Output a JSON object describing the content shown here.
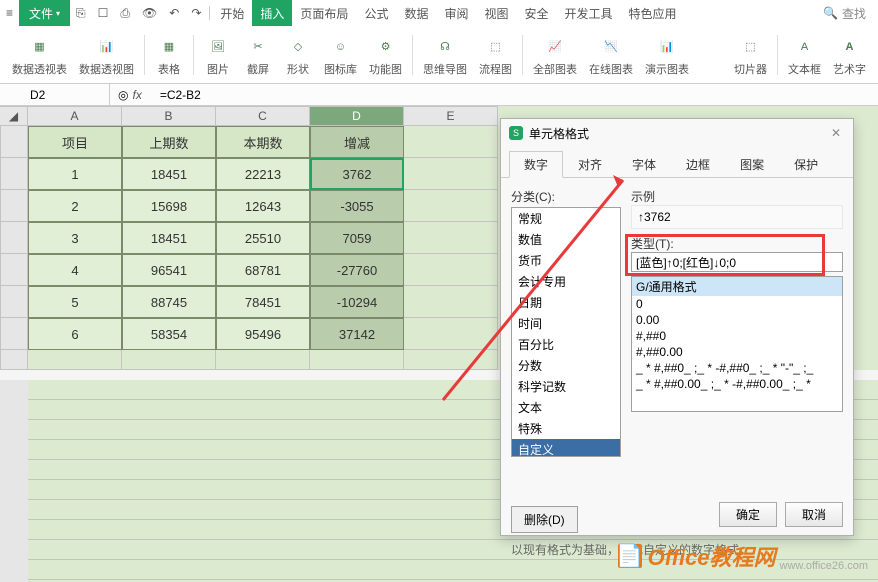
{
  "app": {
    "file_menu": "文件",
    "search": "查找"
  },
  "quickaccess": [
    "home-icon",
    "save-icon",
    "print-icon",
    "preview-icon",
    "undo-icon",
    "redo-icon"
  ],
  "tabs": {
    "start": "开始",
    "insert": "插入",
    "layout": "页面布局",
    "formula": "公式",
    "data": "数据",
    "review": "审阅",
    "view": "视图",
    "security": "安全",
    "dev": "开发工具",
    "special": "特色应用"
  },
  "ribbon": {
    "pivot": "数据透视表",
    "pivotchart": "数据透视图",
    "table": "表格",
    "picture": "图片",
    "screenshot": "截屏",
    "shapes": "形状",
    "icons": "图标库",
    "function": "功能图",
    "mindmap": "思维导图",
    "flowchart": "流程图",
    "allcharts": "全部图表",
    "onlinechart": "在线图表",
    "presentchart": "演示图表",
    "slicer": "切片器",
    "textbox": "文本框",
    "wordart": "艺术字"
  },
  "formula_bar": {
    "cell": "D2",
    "formula": "=C2-B2"
  },
  "table": {
    "cols": [
      "A",
      "B",
      "C",
      "D",
      "E"
    ],
    "headers": {
      "a": "项目",
      "b": "上期数",
      "c": "本期数",
      "d": "增减"
    },
    "rows": [
      {
        "a": "1",
        "b": "18451",
        "c": "22213",
        "d": "3762"
      },
      {
        "a": "2",
        "b": "15698",
        "c": "12643",
        "d": "-3055"
      },
      {
        "a": "3",
        "b": "18451",
        "c": "25510",
        "d": "7059"
      },
      {
        "a": "4",
        "b": "96541",
        "c": "68781",
        "d": "-27760"
      },
      {
        "a": "5",
        "b": "88745",
        "c": "78451",
        "d": "-10294"
      },
      {
        "a": "6",
        "b": "58354",
        "c": "95496",
        "d": "37142"
      }
    ]
  },
  "dialog": {
    "title": "单元格格式",
    "tabs": {
      "number": "数字",
      "align": "对齐",
      "font": "字体",
      "border": "边框",
      "pattern": "图案",
      "protect": "保护"
    },
    "category_label": "分类(C):",
    "categories": [
      "常规",
      "数值",
      "货币",
      "会计专用",
      "日期",
      "时间",
      "百分比",
      "分数",
      "科学记数",
      "文本",
      "特殊",
      "自定义"
    ],
    "selected_category": "自定义",
    "example_label": "示例",
    "example_value": "↑3762",
    "type_label": "类型(T):",
    "type_value": "[蓝色]↑0;[红色]↓0;0",
    "presets": [
      "G/通用格式",
      "0",
      "0.00",
      "#,##0",
      "#,##0.00",
      "_ * #,##0_ ;_ * -#,##0_ ;_ * \"-\"_ ;_ ",
      "_ * #,##0.00_ ;_ * -#,##0.00_ ;_ *"
    ],
    "delete_btn": "删除(D)",
    "hint": "以现有格式为基础，生成自定义的数字格式。",
    "ok": "确定",
    "cancel": "取消"
  },
  "watermark": {
    "text": "Office教程网",
    "url": "www.office26.com"
  }
}
